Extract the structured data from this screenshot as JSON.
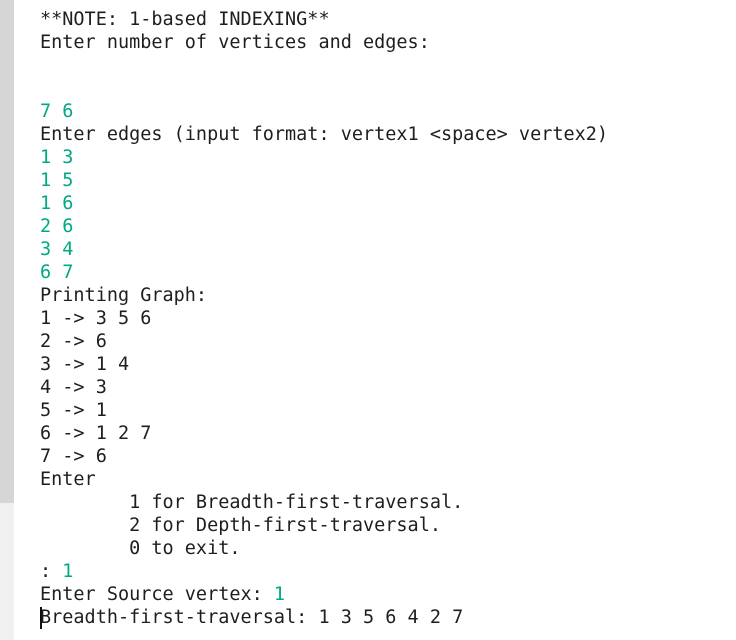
{
  "console": {
    "lines": [
      {
        "text": "**NOTE: 1-based INDEXING**",
        "kind": "out"
      },
      {
        "text": "Enter number of vertices and edges:",
        "kind": "out"
      },
      {
        "text": "",
        "kind": "out"
      },
      {
        "text": "",
        "kind": "out"
      },
      {
        "text": "7 6",
        "kind": "in"
      },
      {
        "text": "Enter edges (input format: vertex1 <space> vertex2)",
        "kind": "out"
      },
      {
        "text": "1 3",
        "kind": "in"
      },
      {
        "text": "1 5",
        "kind": "in"
      },
      {
        "text": "1 6",
        "kind": "in"
      },
      {
        "text": "2 6",
        "kind": "in"
      },
      {
        "text": "3 4",
        "kind": "in"
      },
      {
        "text": "6 7",
        "kind": "in"
      },
      {
        "text": "Printing Graph:",
        "kind": "out"
      },
      {
        "text": "1 -> 3 5 6",
        "kind": "out"
      },
      {
        "text": "2 -> 6",
        "kind": "out"
      },
      {
        "text": "3 -> 1 4",
        "kind": "out"
      },
      {
        "text": "4 -> 3",
        "kind": "out"
      },
      {
        "text": "5 -> 1",
        "kind": "out"
      },
      {
        "text": "6 -> 1 2 7",
        "kind": "out"
      },
      {
        "text": "7 -> 6",
        "kind": "out"
      },
      {
        "text": "Enter",
        "kind": "out"
      },
      {
        "text": "        1 for Breadth-first-traversal.",
        "kind": "out"
      },
      {
        "text": "        2 for Depth-first-traversal.",
        "kind": "out"
      },
      {
        "text": "        0 to exit.",
        "kind": "out"
      },
      {
        "prompt": ": ",
        "input": "1",
        "kind": "mixed"
      },
      {
        "prompt": "Enter Source vertex: ",
        "input": "1",
        "kind": "mixed"
      },
      {
        "text": "Breadth-first-traversal: 1 3 5 6 4 2 7",
        "kind": "out"
      }
    ]
  },
  "colors": {
    "output_text": "#1e1e1e",
    "input_text": "#00a884",
    "gutter": "#d6d6d6",
    "background": "#ffffff"
  }
}
